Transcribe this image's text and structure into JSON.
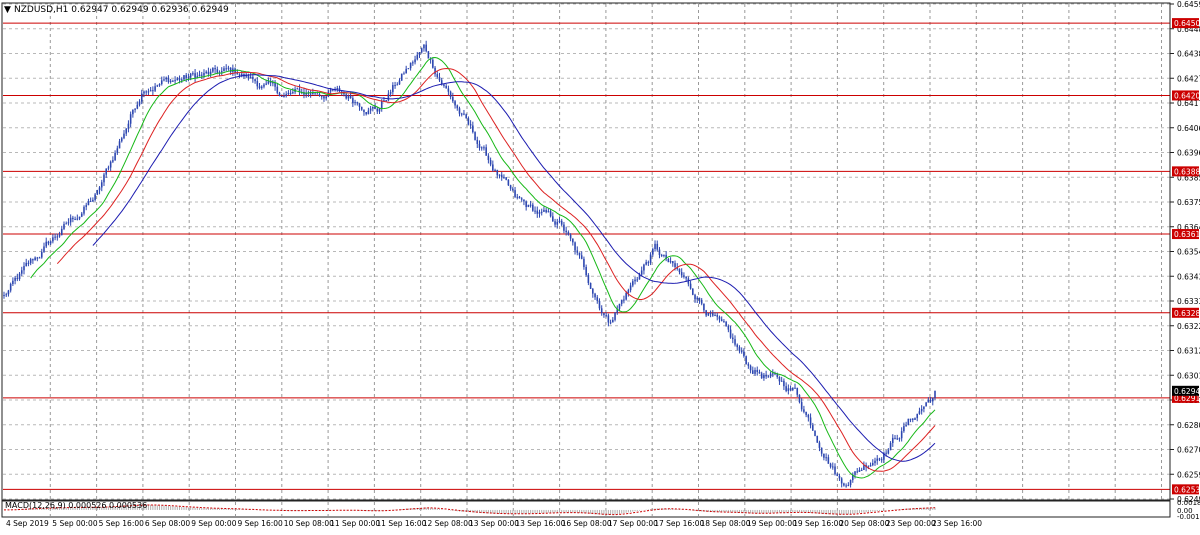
{
  "main_chart": {
    "title": "NZDUSD,H1  0.62947 0.62949 0.62936 0.62949",
    "y_ticks": [
      "0.64590",
      "0.64485",
      "0.64380",
      "0.64275",
      "0.64170",
      "0.64065",
      "0.63960",
      "0.63855",
      "0.63750",
      "0.63645",
      "0.63540",
      "0.63435",
      "0.63330",
      "0.63225",
      "0.63120",
      "0.63015",
      "0.62910",
      "0.62805",
      "0.62700",
      "0.62595",
      "0.62490"
    ],
    "levels": [
      "0.64509",
      "0.64202",
      "0.63880",
      "0.63614",
      "0.63280",
      "0.62919",
      "0.62531"
    ],
    "current_price": "0.62949",
    "level_color": "#cc0000",
    "candle_color": "#2c46b0",
    "ma_colors": [
      "#16b816",
      "#dd2222",
      "#1c1cb0"
    ]
  },
  "macd_panel": {
    "title": "MACD(12,26,9)  0.000526 0.000536",
    "y_ticks": [
      "0.001812",
      "0.00",
      "-0.00138"
    ],
    "histogram_color": "#b0b0b0",
    "signal_color": "#cc0000"
  },
  "x_ticks": [
    "4 Sep 2019",
    "5 Sep 00:00",
    "5 Sep 16:00",
    "6 Sep 08:00",
    "9 Sep 00:00",
    "9 Sep 16:00",
    "10 Sep 08:00",
    "11 Sep 00:00",
    "11 Sep 16:00",
    "12 Sep 08:00",
    "13 Sep 00:00",
    "13 Sep 16:00",
    "16 Sep 08:00",
    "17 Sep 00:00",
    "17 Sep 16:00",
    "18 Sep 08:00",
    "19 Sep 00:00",
    "19 Sep 16:00",
    "20 Sep 08:00",
    "23 Sep 00:00",
    "23 Sep 16:00"
  ],
  "chart_data": {
    "type": "candlestick",
    "symbol": "NZDUSD",
    "timeframe": "H1",
    "ohlc_last": {
      "open": 0.62947,
      "high": 0.62949,
      "low": 0.62936,
      "close": 0.62949
    },
    "ylim": [
      0.6249,
      0.6459
    ],
    "close_path": [
      {
        "x": "4 Sep 2019",
        "y": 0.6335
      },
      {
        "x": "5 Sep 00:00",
        "y": 0.6358
      },
      {
        "x": "5 Sep 16:00",
        "y": 0.6378
      },
      {
        "x": "6 Sep 08:00",
        "y": 0.6425
      },
      {
        "x": "9 Sep 00:00",
        "y": 0.6428
      },
      {
        "x": "9 Sep 16:00",
        "y": 0.643
      },
      {
        "x": "10 Sep 08:00",
        "y": 0.642
      },
      {
        "x": "11 Sep 00:00",
        "y": 0.6422
      },
      {
        "x": "11 Sep 16:00",
        "y": 0.6415
      },
      {
        "x": "12 Sep 08:00",
        "y": 0.644
      },
      {
        "x": "13 Sep 00:00",
        "y": 0.6405
      },
      {
        "x": "13 Sep 16:00",
        "y": 0.6375
      },
      {
        "x": "16 Sep 08:00",
        "y": 0.6365
      },
      {
        "x": "17 Sep 00:00",
        "y": 0.6325
      },
      {
        "x": "17 Sep 16:00",
        "y": 0.6355
      },
      {
        "x": "18 Sep 08:00",
        "y": 0.6333
      },
      {
        "x": "19 Sep 00:00",
        "y": 0.6305
      },
      {
        "x": "19 Sep 16:00",
        "y": 0.6295
      },
      {
        "x": "20 Sep 08:00",
        "y": 0.6256
      },
      {
        "x": "23 Sep 00:00",
        "y": 0.6272
      },
      {
        "x": "23 Sep 16:00",
        "y": 0.6294
      }
    ],
    "horizontal_levels": [
      0.64509,
      0.64202,
      0.6388,
      0.63614,
      0.6328,
      0.62919,
      0.62531
    ],
    "macd": {
      "params": "12,26,9",
      "main": 0.000526,
      "signal": 0.000536,
      "ylim": [
        -0.00138,
        0.001812
      ]
    },
    "grid": true
  }
}
